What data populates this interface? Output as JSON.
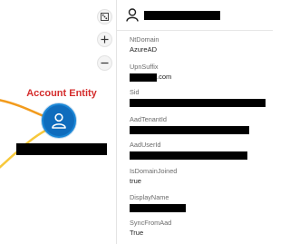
{
  "graph": {
    "entity_label": "Account Entity",
    "controls": [
      "fit-to-screen",
      "zoom-in",
      "zoom-out"
    ],
    "colors": {
      "edge_orange": "#f29b1d",
      "edge_yellow": "#f7c83b",
      "node": "#0f6cbd",
      "label": "#d42c2c"
    }
  },
  "panel": {
    "title": "",
    "fields": [
      {
        "label": "NtDomain",
        "value": "AzureAD"
      },
      {
        "label": "UpnSuffix",
        "value": ".com"
      },
      {
        "label": "Sid",
        "value": ""
      },
      {
        "label": "AadTenantId",
        "value": ""
      },
      {
        "label": "AadUserId",
        "value": ""
      },
      {
        "label": "IsDomainJoined",
        "value": "true"
      },
      {
        "label": "DisplayName",
        "value": ""
      },
      {
        "label": "SyncFromAad",
        "value": "True"
      }
    ]
  }
}
